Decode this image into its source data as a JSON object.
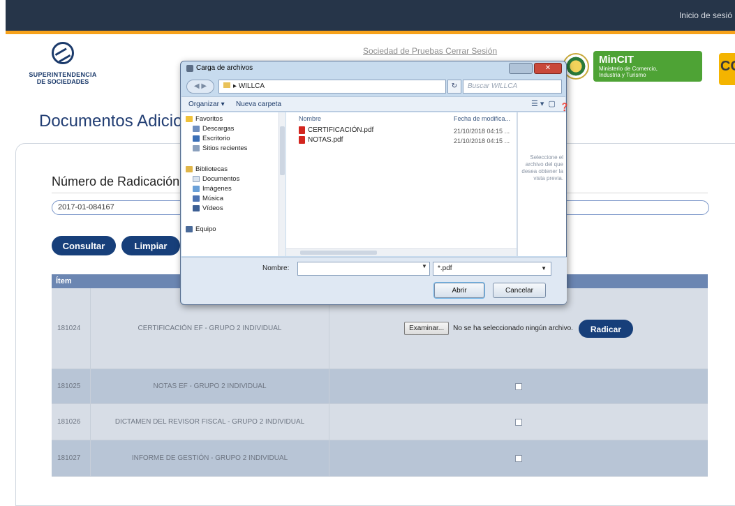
{
  "header": {
    "login_link": "Inicio de sesió",
    "user_line": "Sociedad de Pruebas   Cerrar Sesión"
  },
  "logos": {
    "ss_line1": "SUPERINTENDENCIA",
    "ss_line2": "DE SOCIEDADES",
    "mincit_title": "MinCIT",
    "mincit_sub1": "Ministerio de Comercio,",
    "mincit_sub2": "Industria y Turismo",
    "right_logo_text": "CC"
  },
  "page": {
    "title": "Documentos Adicionales",
    "subtitle": "Número de Radicación",
    "radicacion_value": "2017-01-084167",
    "buttons": {
      "consultar": "Consultar",
      "limpiar": "Limpiar"
    }
  },
  "table": {
    "header_item": "Ítem",
    "rows": [
      {
        "item": "181024",
        "doc": "CERTIFICACIÓN EF - GRUPO 2 INDIVIDUAL",
        "file_button": "Examinar...",
        "file_msg": "No se ha seleccionado ningún archivo.",
        "radicar": "Radicar"
      },
      {
        "item": "181025",
        "doc": "NOTAS EF - GRUPO 2 INDIVIDUAL"
      },
      {
        "item": "181026",
        "doc": "DICTAMEN DEL REVISOR FISCAL - GRUPO 2 INDIVIDUAL"
      },
      {
        "item": "181027",
        "doc": "INFORME DE GESTIÓN - GRUPO 2 INDIVIDUAL"
      }
    ]
  },
  "dialog": {
    "title": "Carga de archivos",
    "address": "WILLCA",
    "search_placeholder": "Buscar WILLCA",
    "organize": "Organizar ▾",
    "new_folder": "Nueva carpeta",
    "nav": {
      "favorites": "Favoritos",
      "downloads": "Descargas",
      "desktop": "Escritorio",
      "recent": "Sitios recientes",
      "libraries": "Bibliotecas",
      "documents": "Documentos",
      "images": "Imágenes",
      "music": "Música",
      "videos": "Vídeos",
      "group": "Equipo"
    },
    "col_name": "Nombre",
    "col_date": "Fecha de modifica...",
    "files": [
      {
        "name": "CERTIFICACIÓN.pdf",
        "date": "21/10/2018 04:15 ..."
      },
      {
        "name": "NOTAS.pdf",
        "date": "21/10/2018 04:15 ..."
      }
    ],
    "preview_text": "Seleccione el archivo del que desea obtener la vista previa.",
    "name_label": "Nombre:",
    "name_value": "",
    "filetype": "*.pdf",
    "open": "Abrir",
    "cancel": "Cancelar"
  }
}
